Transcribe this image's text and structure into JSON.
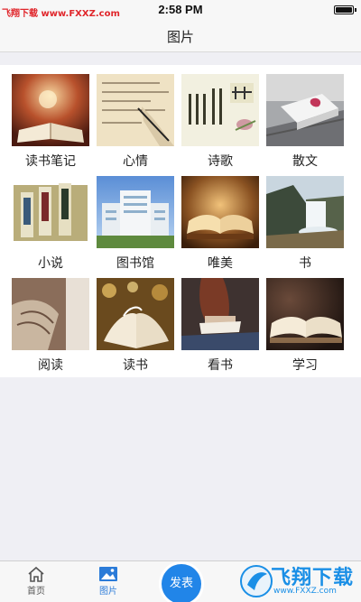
{
  "watermark": "飞翔下载 www.FXXZ.com",
  "status_bar": {
    "time": "2:58 PM",
    "battery_level": 1.0
  },
  "nav": {
    "title": "图片"
  },
  "grid": [
    {
      "label": "读书笔记",
      "image": "open-book-glow"
    },
    {
      "label": "心情",
      "image": "handwriting-note"
    },
    {
      "label": "诗歌",
      "image": "poem-scroll"
    },
    {
      "label": "散文",
      "image": "book-on-bench"
    },
    {
      "label": "小说",
      "image": "ancient-scrolls"
    },
    {
      "label": "图书馆",
      "image": "library-building"
    },
    {
      "label": "唯美",
      "image": "warm-open-book"
    },
    {
      "label": "书",
      "image": "waterfall"
    },
    {
      "label": "阅读",
      "image": "reading-pages"
    },
    {
      "label": "读书",
      "image": "bokeh-book"
    },
    {
      "label": "看书",
      "image": "girl-reading"
    },
    {
      "label": "学习",
      "image": "dark-open-book"
    }
  ],
  "tabs": [
    {
      "label": "首页",
      "icon": "home-icon",
      "active": false
    },
    {
      "label": "图片",
      "icon": "image-icon",
      "active": true
    }
  ],
  "publish_button": "发表",
  "logo_watermark": {
    "text": "飞翔下载",
    "url": "www.FXXZ.com"
  },
  "colors": {
    "accent": "#2185e8",
    "background": "#efeff4",
    "panel": "#ffffff"
  }
}
